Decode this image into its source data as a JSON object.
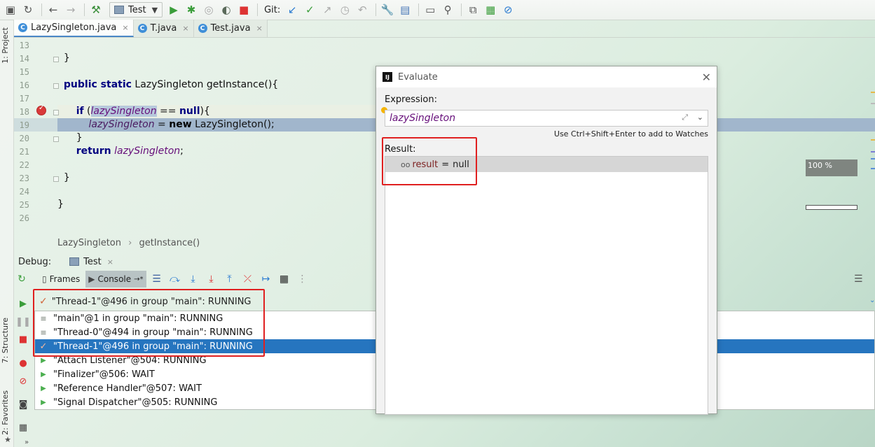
{
  "toolbar": {
    "run_config": "Test",
    "git_label": "Git:"
  },
  "left_stripe": {
    "project": "1: Project",
    "structure": "7: Structure",
    "favorites": "2: Favorites"
  },
  "editor_tabs": [
    {
      "label": "LazySingleton.java",
      "close": "×"
    },
    {
      "label": "T.java",
      "close": "×"
    },
    {
      "label": "Test.java",
      "close": "×"
    }
  ],
  "editor": {
    "line_numbers": [
      "13",
      "14",
      "15",
      "16",
      "17",
      "18",
      "19",
      "20",
      "21",
      "22",
      "23",
      "24",
      "25",
      "26"
    ],
    "breadcrumb": [
      "LazySingleton",
      "getInstance()"
    ],
    "breadcrumb_sep": "›"
  },
  "debug": {
    "label": "Debug:",
    "session_tab": "Test",
    "frames_tab": "Frames",
    "console_tab": "Console",
    "console_suffix": "→*",
    "current_thread": "\"Thread-1\"@496 in group \"main\": RUNNING",
    "threads": [
      {
        "label": "\"main\"@1 in group \"main\": RUNNING",
        "icon": "list-icon"
      },
      {
        "label": "\"Thread-0\"@494 in group \"main\": RUNNING",
        "icon": "list-icon"
      },
      {
        "label": "\"Thread-1\"@496 in group \"main\": RUNNING",
        "icon": "check-icon"
      },
      {
        "label": "\"Attach Listener\"@504: RUNNING",
        "icon": "play-icon"
      },
      {
        "label": "\"Finalizer\"@506: WAIT",
        "icon": "play-icon"
      },
      {
        "label": "\"Reference Handler\"@507: WAIT",
        "icon": "play-icon"
      },
      {
        "label": "\"Signal Dispatcher\"@505: RUNNING",
        "icon": "play-icon"
      }
    ]
  },
  "evaluate": {
    "title": "Evaluate",
    "expression_label": "Expression:",
    "expression_value": "lazySingleton",
    "hint": "Use Ctrl+Shift+Enter to add to Watches",
    "result_label": "Result:",
    "result_name": "result",
    "result_eq": "=",
    "result_value": "null"
  },
  "gauge": {
    "label": "100 %"
  },
  "colors": {
    "accent_selection": "#2675bf",
    "highlight_box": "#e02020",
    "execution_line": "#a1b6cc",
    "field_purple": "#660e7a",
    "keyword_navy": "#000080"
  }
}
